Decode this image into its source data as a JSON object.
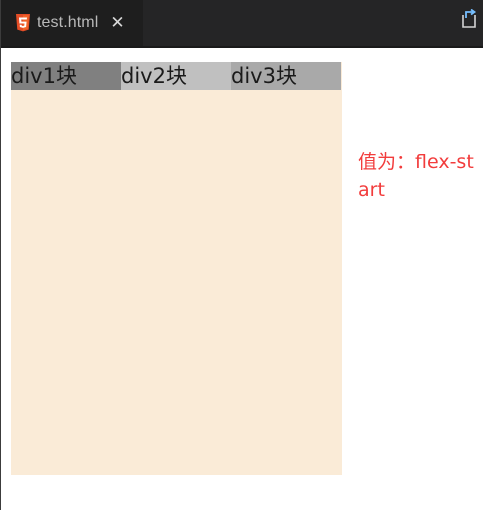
{
  "editor": {
    "tab": {
      "label": "test.html",
      "close_glyph": "✕",
      "icon": "html5-icon"
    },
    "toolbar": {
      "open_preview_icon": "open-preview-icon"
    }
  },
  "content": {
    "blocks": [
      {
        "label": "div1块",
        "color": "#808080"
      },
      {
        "label": "div2块",
        "color": "#c0c0c0"
      },
      {
        "label": "div3块",
        "color": "#a9a9a9"
      }
    ],
    "container_color": "#faebd7",
    "note": "值为：flex-start",
    "note_color": "#f23c3c"
  }
}
